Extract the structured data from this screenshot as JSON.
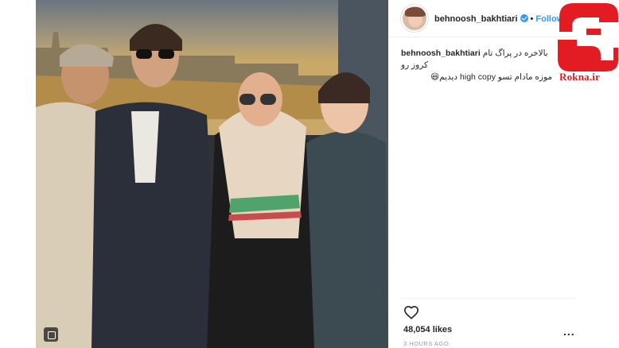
{
  "post": {
    "username": "behnoosh_bakhtiari",
    "follow_label": "Follow",
    "dot": "•",
    "caption_user": "behnoosh_bakhtiari",
    "caption_line1": "بالاخره در پراگ تام کروز رو",
    "caption_line2": "موزه مادام تسو high copy دیدیم😆",
    "likes": "48,054 likes",
    "time": "3 HOURS AGO",
    "more": "..."
  },
  "logo": {
    "text": "Rokna.ir",
    "color": "#e31b23"
  },
  "colors": {
    "link": "#3897f0",
    "text": "#262626",
    "muted": "#999999"
  },
  "icons": {
    "heart": "heart-icon",
    "verified": "verified-badge-icon",
    "multi": "multiple-photos-icon"
  }
}
